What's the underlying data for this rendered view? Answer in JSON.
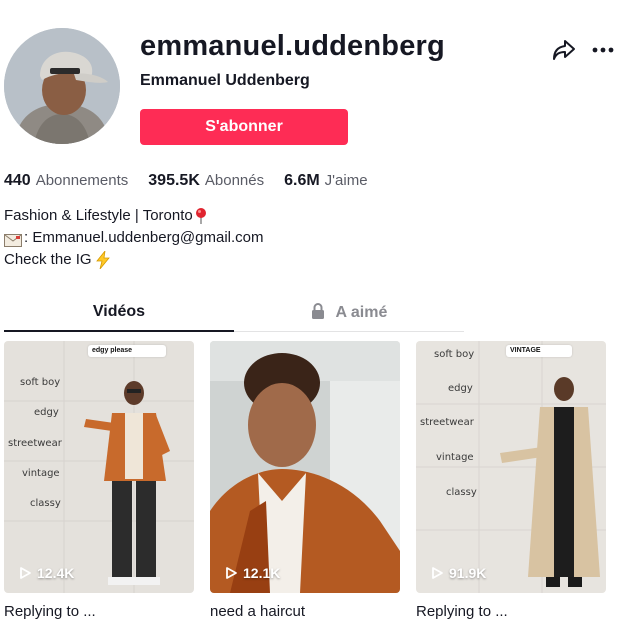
{
  "profile": {
    "username": "emmanuel.uddenberg",
    "nickname": "Emmanuel Uddenberg",
    "follow_label": "S'abonner"
  },
  "stats": [
    {
      "value": "440",
      "label": "Abonnements"
    },
    {
      "value": "395.5K",
      "label": "Abonnés"
    },
    {
      "value": "6.6M",
      "label": "J'aime"
    }
  ],
  "bio": {
    "line1": "Fashion & Lifestyle | Toronto",
    "line2": ": Emmanuel.uddenberg@gmail.com",
    "line3": "Check the IG"
  },
  "tabs": {
    "videos": "Vidéos",
    "liked": "A aimé"
  },
  "videos": [
    {
      "views": "12.4K",
      "caption": "Replying to ...",
      "overlay_words": [
        "soft boy",
        "edgy",
        "streetwear",
        "vintage",
        "classy"
      ],
      "bubble_label": "edgy please"
    },
    {
      "views": "12.1K",
      "caption": "need a haircut"
    },
    {
      "views": "91.9K",
      "caption": "Replying to ...",
      "overlay_words": [
        "soft boy",
        "edgy",
        "streetwear",
        "vintage",
        "classy"
      ],
      "bubble_label": "VINTAGE"
    }
  ],
  "colors": {
    "accent": "#fe2c55",
    "text": "#161823",
    "muted": "#5a5c66"
  },
  "icons": {
    "share": "share-arrow-icon",
    "more": "more-dots-icon",
    "pin": "round-pushpin-icon",
    "mail": "envelope-icon",
    "bolt": "high-voltage-icon",
    "lock": "lock-icon",
    "play": "play-icon"
  }
}
